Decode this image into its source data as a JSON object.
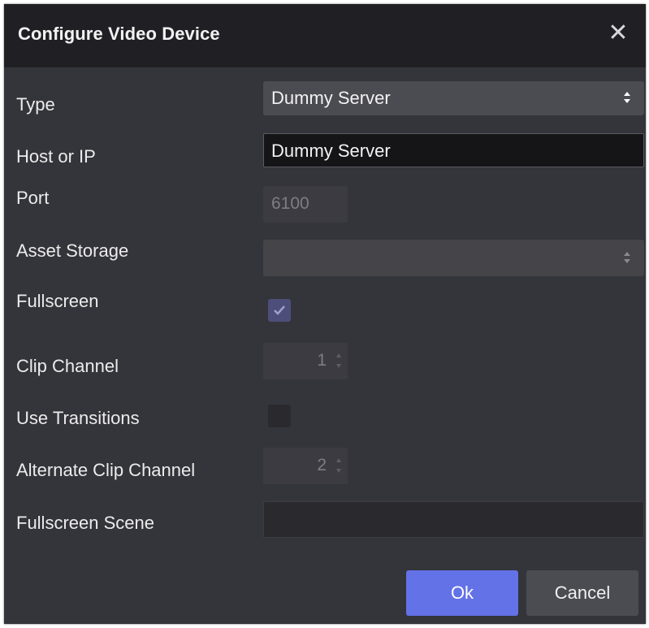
{
  "dialog": {
    "title": "Configure Video Device",
    "close_icon": "close-icon"
  },
  "form": {
    "type": {
      "label": "Type",
      "value": "Dummy Server"
    },
    "host": {
      "label": "Host or IP",
      "value": "Dummy Server"
    },
    "port": {
      "label": "Port",
      "value": "6100"
    },
    "asset_storage": {
      "label": "Asset Storage",
      "value": ""
    },
    "fullscreen": {
      "label": "Fullscreen",
      "checked": true
    },
    "clip_channel": {
      "label": "Clip Channel",
      "value": "1"
    },
    "use_transitions": {
      "label": "Use Transitions",
      "checked": false
    },
    "alternate_clip_channel": {
      "label": "Alternate Clip Channel",
      "value": "2"
    },
    "fullscreen_scene": {
      "label": "Fullscreen Scene",
      "value": ""
    }
  },
  "buttons": {
    "ok": "Ok",
    "cancel": "Cancel"
  },
  "colors": {
    "accent": "#6372e6",
    "dialog_bg": "#34343b",
    "titlebar_bg": "#202024"
  }
}
